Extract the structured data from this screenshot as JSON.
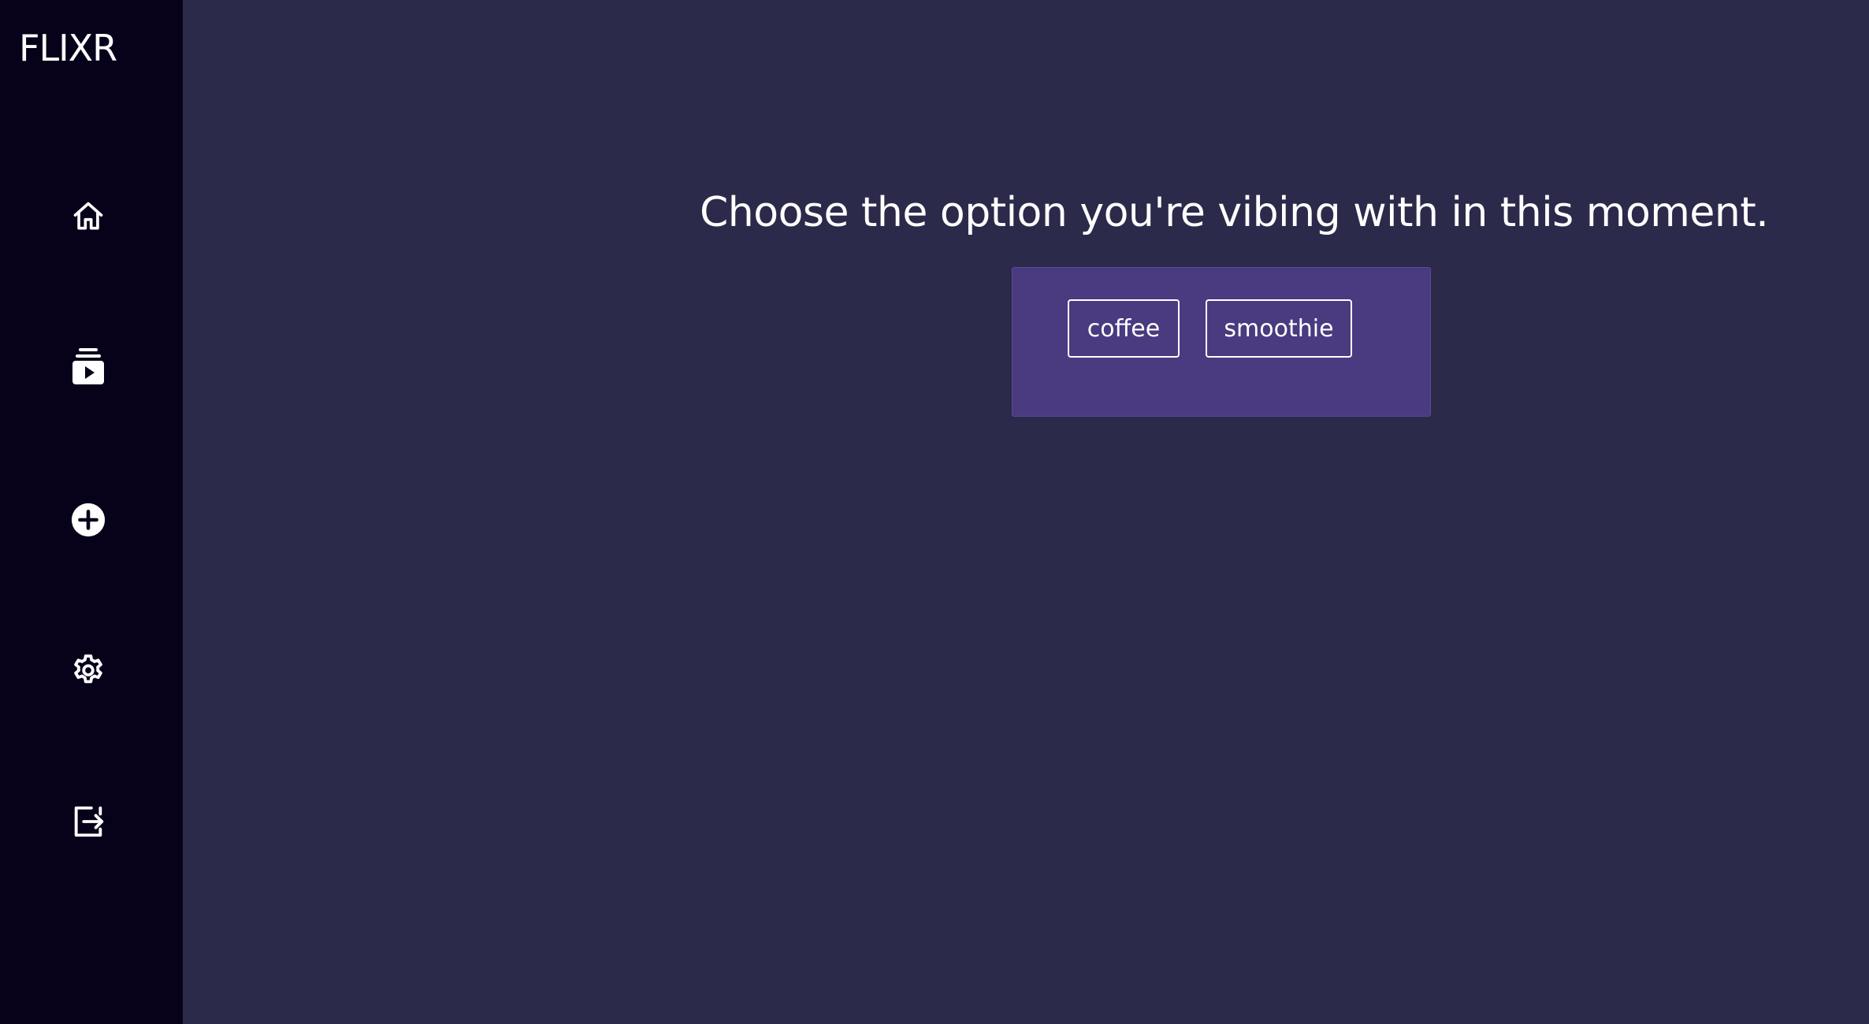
{
  "app": {
    "logo": "FLIXR"
  },
  "sidebar": {
    "items": [
      {
        "icon": "home-icon"
      },
      {
        "icon": "video-library-icon"
      },
      {
        "icon": "add-circle-icon"
      },
      {
        "icon": "gear-icon"
      },
      {
        "icon": "logout-icon"
      }
    ]
  },
  "main": {
    "prompt": "Choose the option you're vibing with in this moment.",
    "options": [
      {
        "label": "coffee"
      },
      {
        "label": "smoothie"
      }
    ]
  },
  "colors": {
    "background": "#2b2a4a",
    "sidebar": "#07021a",
    "panel": "#4a3a80",
    "text": "#ffffff"
  }
}
